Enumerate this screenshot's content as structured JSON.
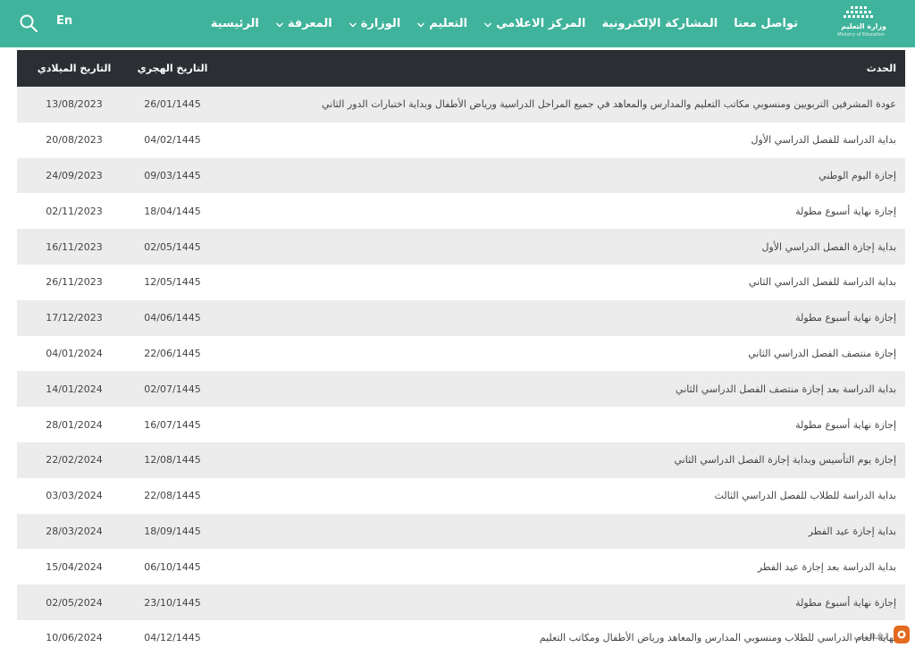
{
  "header": {
    "lang_label": "En",
    "logo_title": "وزارة التعليم",
    "logo_subtitle": "Ministry of Education",
    "nav": [
      {
        "label": "الرئيسية",
        "has_dropdown": false
      },
      {
        "label": "المعرفة",
        "has_dropdown": true
      },
      {
        "label": "الوزارة",
        "has_dropdown": true
      },
      {
        "label": "التعليم",
        "has_dropdown": true
      },
      {
        "label": "المركز الاعلامي",
        "has_dropdown": true
      },
      {
        "label": "المشاركة الإلكترونية",
        "has_dropdown": false
      },
      {
        "label": "تواصل معنا",
        "has_dropdown": false
      }
    ]
  },
  "table": {
    "headers": {
      "event": "الحدث",
      "hijri": "التاريخ الهجري",
      "gregorian": "التاريخ الميلادي"
    },
    "rows": [
      {
        "event": "عودة المشرفين التربويين ومنسوبي مكاتب التعليم والمدارس والمعاهد في جميع المراحل الدراسية ورياض الأطفال وبداية اختبارات الدور الثاني",
        "hijri": "26/01/1445",
        "gregorian": "13/08/2023"
      },
      {
        "event": "بداية الدراسة للفصل الدراسي الأول",
        "hijri": "04/02/1445",
        "gregorian": "20/08/2023"
      },
      {
        "event": "إجازة اليوم الوطني",
        "hijri": "09/03/1445",
        "gregorian": "24/09/2023"
      },
      {
        "event": "إجازة نهاية أسبوع مطولة",
        "hijri": "18/04/1445",
        "gregorian": "02/11/2023"
      },
      {
        "event": "بداية إجازة الفصل الدراسي الأول",
        "hijri": "02/05/1445",
        "gregorian": "16/11/2023"
      },
      {
        "event": "بداية الدراسة للفصل الدراسي الثاني",
        "hijri": "12/05/1445",
        "gregorian": "26/11/2023"
      },
      {
        "event": "إجازة نهاية أسبوع مطولة",
        "hijri": "04/06/1445",
        "gregorian": "17/12/2023"
      },
      {
        "event": "إجازة منتصف الفصل الدراسي الثاني",
        "hijri": "22/06/1445",
        "gregorian": "04/01/2024"
      },
      {
        "event": "بداية الدراسة بعد إجازة منتصف الفصل الدراسي الثاني",
        "hijri": "02/07/1445",
        "gregorian": "14/01/2024"
      },
      {
        "event": "إجازة نهاية أسبوع مطولة",
        "hijri": "16/07/1445",
        "gregorian": "28/01/2024"
      },
      {
        "event": "إجازة يوم التأسيس وبداية إجازة الفصل الدراسي الثاني",
        "hijri": "12/08/1445",
        "gregorian": "22/02/2024"
      },
      {
        "event": "بداية الدراسة للطلاب للفصل الدراسي الثالث",
        "hijri": "22/08/1445",
        "gregorian": "03/03/2024"
      },
      {
        "event": "بداية إجازة عيد الفطر",
        "hijri": "18/09/1445",
        "gregorian": "28/03/2024"
      },
      {
        "event": "بداية الدراسة بعد إجازة عيد الفطر",
        "hijri": "06/10/1445",
        "gregorian": "15/04/2024"
      },
      {
        "event": "إجازة نهاية أسبوع مطولة",
        "hijri": "23/10/1445",
        "gregorian": "02/05/2024"
      },
      {
        "event": "نهاية العام الدراسي للطلاب ومنسوبي المدارس والمعاهد ورياض الأطفال ومكاتب التعليم",
        "hijri": "04/12/1445",
        "gregorian": "10/06/2024"
      }
    ]
  },
  "watermark": {
    "text": "ثقفني"
  },
  "colors": {
    "header_bg": "#3fb39b",
    "table_head_bg": "#2b2e33",
    "row_alt_bg": "#ececec"
  }
}
